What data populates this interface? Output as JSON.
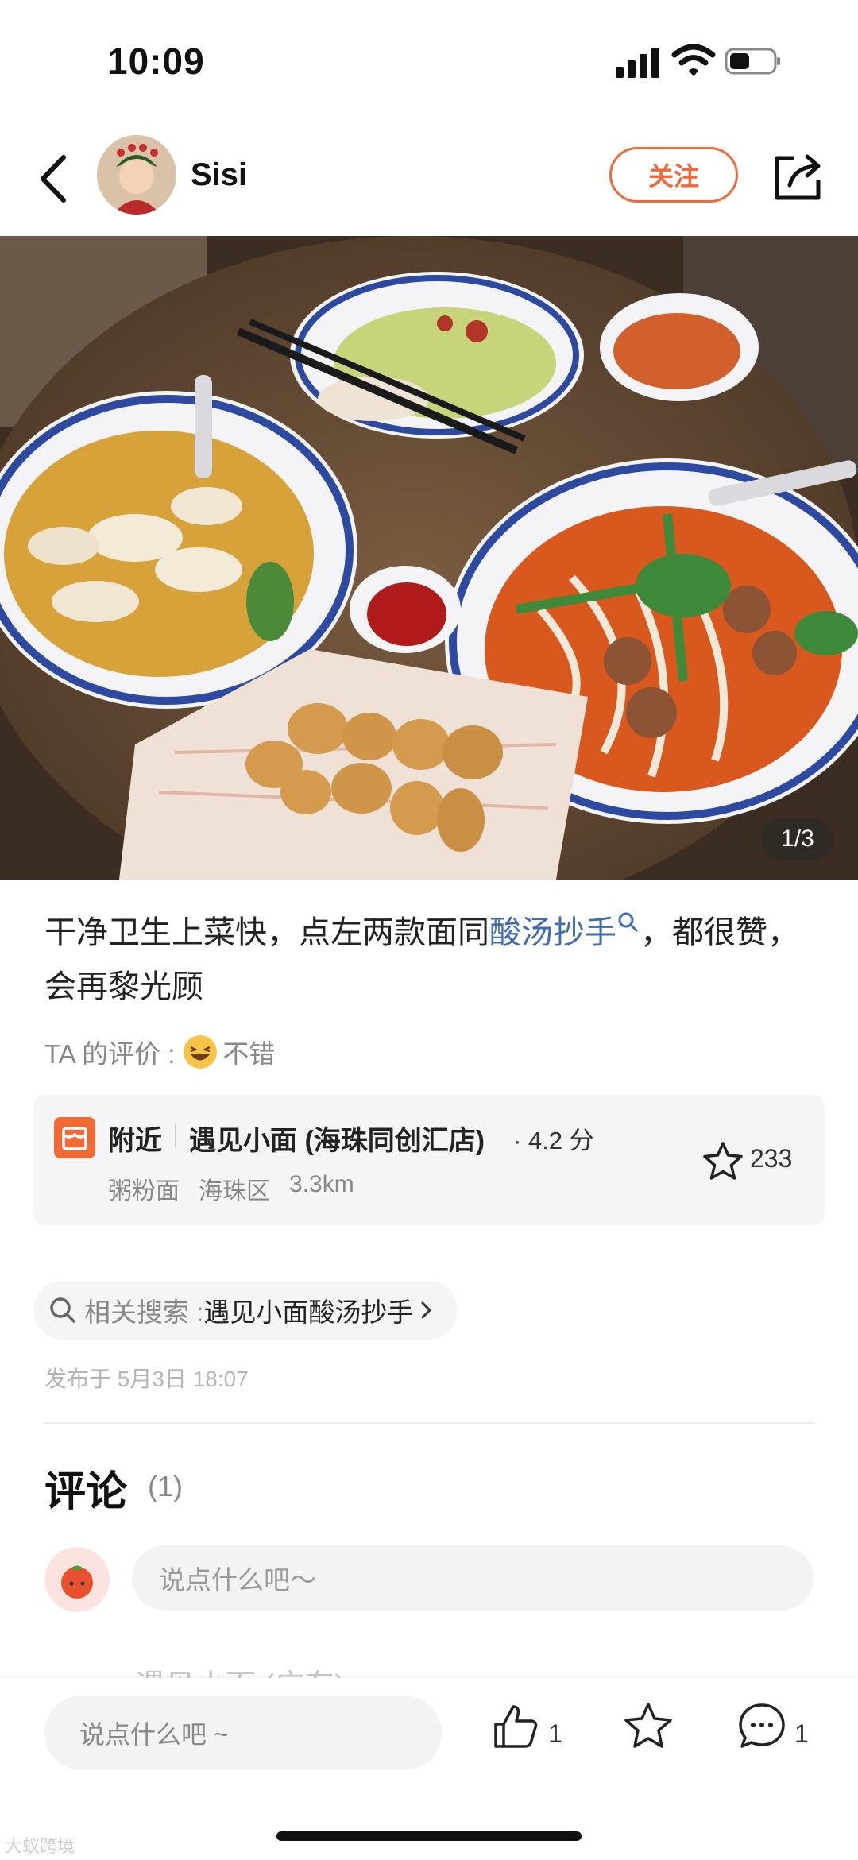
{
  "status_bar": {
    "time": "10:09"
  },
  "header": {
    "user_name": "Sisi",
    "follow_label": "关注"
  },
  "photo": {
    "page_counter": "1/3"
  },
  "post": {
    "text_before": "干净卫生上菜快，点左两款面同",
    "link_text": "酸汤抄手",
    "text_after": "，都很赞，会再黎光顾",
    "rating_label": "TA 的评价 :",
    "rating_value": "不错"
  },
  "shop_card": {
    "nearby_label": "附近",
    "name": "遇见小面 (海珠同创汇店)",
    "score": "· 4.2 分",
    "category": "粥粉面",
    "district": "海珠区",
    "distance": "3.3km",
    "favorite_count": "233"
  },
  "related_search": {
    "label": "相关搜索 :",
    "value": "遇见小面酸汤抄手"
  },
  "publish_time": "发布于 5月3日 18:07",
  "comments": {
    "title": "评论",
    "count": "(1)",
    "input_placeholder": "说点什么吧～",
    "faded_preview": "遇见小面 (广东)"
  },
  "bottom_bar": {
    "input_placeholder": "说点什么吧 ~",
    "like_count": "1",
    "comment_count": "1"
  },
  "watermark": "大蚁跨境",
  "colors": {
    "accent": "#ee6a3b",
    "link": "#3f6bb0",
    "shop_icon": "#f06a35"
  }
}
